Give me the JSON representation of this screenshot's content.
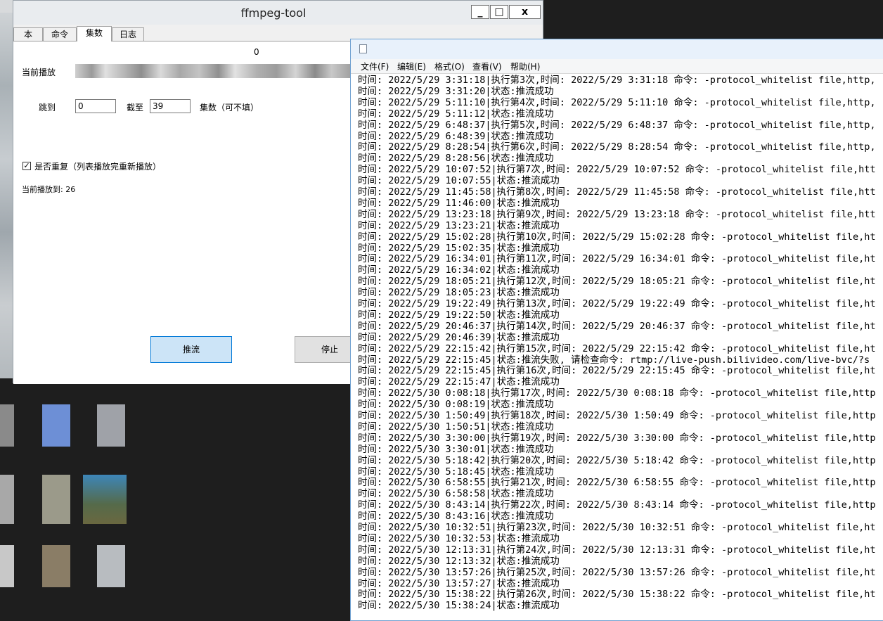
{
  "tool_window": {
    "title": "ffmpeg-tool",
    "controls": {
      "minimize": "_",
      "maximize": "□",
      "close": "x"
    },
    "tabs": [
      "本",
      "命令",
      "集数",
      "日志"
    ],
    "active_tab": 2,
    "counter": "0",
    "now_playing_label": "当前播放",
    "jump_label": "跳到",
    "jump_value": "0",
    "until_label": "截至",
    "until_value": "39",
    "episodes_hint": "集数（可不填）",
    "repeat_label": "是否重复（列表播放完重新播放）",
    "repeat_checked": "✓",
    "played_to": "当前播放到: 26",
    "push_button": "推流",
    "stop_button": "停止"
  },
  "notepad": {
    "menu": [
      "文件(F)",
      "编辑(E)",
      "格式(O)",
      "查看(V)",
      "帮助(H)"
    ],
    "lines": [
      "时间: 2022/5/29 3:31:18|执行第3次,时间: 2022/5/29 3:31:18 命令: -protocol_whitelist file,http,",
      "时间: 2022/5/29 3:31:20|状态:推流成功",
      "时间: 2022/5/29 5:11:10|执行第4次,时间: 2022/5/29 5:11:10 命令: -protocol_whitelist file,http,",
      "时间: 2022/5/29 5:11:12|状态:推流成功",
      "时间: 2022/5/29 6:48:37|执行第5次,时间: 2022/5/29 6:48:37 命令: -protocol_whitelist file,http,",
      "时间: 2022/5/29 6:48:39|状态:推流成功",
      "时间: 2022/5/29 8:28:54|执行第6次,时间: 2022/5/29 8:28:54 命令: -protocol_whitelist file,http,",
      "时间: 2022/5/29 8:28:56|状态:推流成功",
      "时间: 2022/5/29 10:07:52|执行第7次,时间: 2022/5/29 10:07:52 命令: -protocol_whitelist file,htt",
      "时间: 2022/5/29 10:07:55|状态:推流成功",
      "时间: 2022/5/29 11:45:58|执行第8次,时间: 2022/5/29 11:45:58 命令: -protocol_whitelist file,htt",
      "时间: 2022/5/29 11:46:00|状态:推流成功",
      "时间: 2022/5/29 13:23:18|执行第9次,时间: 2022/5/29 13:23:18 命令: -protocol_whitelist file,htt",
      "时间: 2022/5/29 13:23:21|状态:推流成功",
      "时间: 2022/5/29 15:02:28|执行第10次,时间: 2022/5/29 15:02:28 命令: -protocol_whitelist file,ht",
      "时间: 2022/5/29 15:02:35|状态:推流成功",
      "时间: 2022/5/29 16:34:01|执行第11次,时间: 2022/5/29 16:34:01 命令: -protocol_whitelist file,ht",
      "时间: 2022/5/29 16:34:02|状态:推流成功",
      "时间: 2022/5/29 18:05:21|执行第12次,时间: 2022/5/29 18:05:21 命令: -protocol_whitelist file,ht",
      "时间: 2022/5/29 18:05:23|状态:推流成功",
      "时间: 2022/5/29 19:22:49|执行第13次,时间: 2022/5/29 19:22:49 命令: -protocol_whitelist file,ht",
      "时间: 2022/5/29 19:22:50|状态:推流成功",
      "时间: 2022/5/29 20:46:37|执行第14次,时间: 2022/5/29 20:46:37 命令: -protocol_whitelist file,ht",
      "时间: 2022/5/29 20:46:39|状态:推流成功",
      "时间: 2022/5/29 22:15:42|执行第15次,时间: 2022/5/29 22:15:42 命令: -protocol_whitelist file,ht",
      "时间: 2022/5/29 22:15:45|状态:推流失败, 请检查命令: rtmp://live-push.bilivideo.com/live-bvc/?s",
      "时间: 2022/5/29 22:15:45|执行第16次,时间: 2022/5/29 22:15:45 命令: -protocol_whitelist file,ht",
      "时间: 2022/5/29 22:15:47|状态:推流成功",
      "时间: 2022/5/30 0:08:18|执行第17次,时间: 2022/5/30 0:08:18 命令: -protocol_whitelist file,http",
      "时间: 2022/5/30 0:08:19|状态:推流成功",
      "时间: 2022/5/30 1:50:49|执行第18次,时间: 2022/5/30 1:50:49 命令: -protocol_whitelist file,http",
      "时间: 2022/5/30 1:50:51|状态:推流成功",
      "时间: 2022/5/30 3:30:00|执行第19次,时间: 2022/5/30 3:30:00 命令: -protocol_whitelist file,http",
      "时间: 2022/5/30 3:30:01|状态:推流成功",
      "时间: 2022/5/30 5:18:42|执行第20次,时间: 2022/5/30 5:18:42 命令: -protocol_whitelist file,http",
      "时间: 2022/5/30 5:18:45|状态:推流成功",
      "时间: 2022/5/30 6:58:55|执行第21次,时间: 2022/5/30 6:58:55 命令: -protocol_whitelist file,http",
      "时间: 2022/5/30 6:58:58|状态:推流成功",
      "时间: 2022/5/30 8:43:14|执行第22次,时间: 2022/5/30 8:43:14 命令: -protocol_whitelist file,http",
      "时间: 2022/5/30 8:43:16|状态:推流成功",
      "时间: 2022/5/30 10:32:51|执行第23次,时间: 2022/5/30 10:32:51 命令: -protocol_whitelist file,ht",
      "时间: 2022/5/30 10:32:53|状态:推流成功",
      "时间: 2022/5/30 12:13:31|执行第24次,时间: 2022/5/30 12:13:31 命令: -protocol_whitelist file,ht",
      "时间: 2022/5/30 12:13:32|状态:推流成功",
      "时间: 2022/5/30 13:57:26|执行第25次,时间: 2022/5/30 13:57:26 命令: -protocol_whitelist file,ht",
      "时间: 2022/5/30 13:57:27|状态:推流成功",
      "时间: 2022/5/30 15:38:22|执行第26次,时间: 2022/5/30 15:38:22 命令: -protocol_whitelist file,ht",
      "时间: 2022/5/30 15:38:24|状态:推流成功"
    ]
  }
}
